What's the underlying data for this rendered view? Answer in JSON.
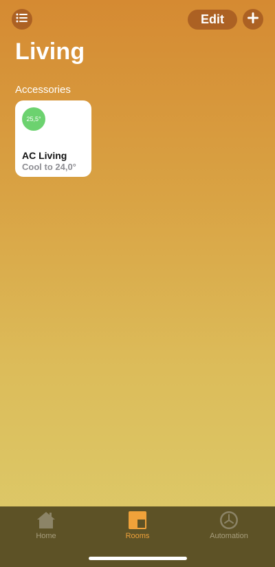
{
  "header": {
    "edit_label": "Edit",
    "title": "Living"
  },
  "icons": {
    "list": "list-icon",
    "add": "plus-icon",
    "home": "house-icon",
    "rooms": "rooms-icon",
    "automation": "clock-icon"
  },
  "section": {
    "title": "Accessories"
  },
  "accessory": {
    "temperature": "25,5°",
    "name": "AC Living",
    "status": "Cool to 24,0°",
    "badge_color": "#6cd26f"
  },
  "tab_bar": {
    "tabs": [
      {
        "label": "Home"
      },
      {
        "label": "Rooms"
      },
      {
        "label": "Automation"
      }
    ],
    "active": "Rooms",
    "active_color": "#f0a23a"
  }
}
